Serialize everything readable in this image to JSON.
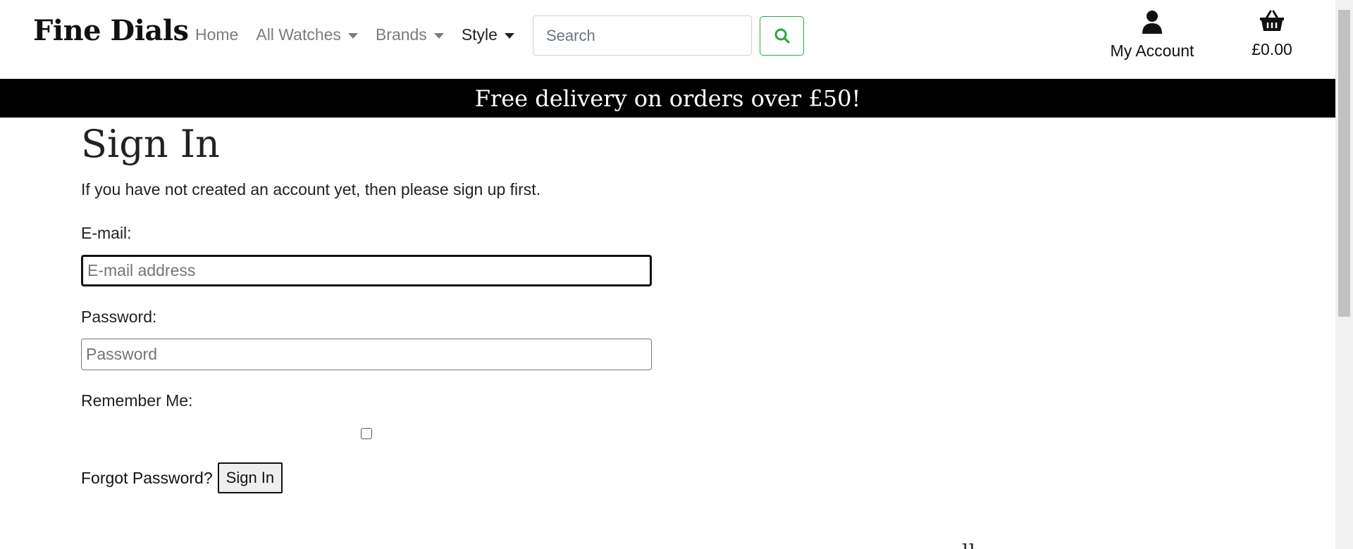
{
  "header": {
    "logo": "Fine Dials",
    "nav": [
      {
        "label": "Home",
        "has_caret": false
      },
      {
        "label": "All Watches",
        "has_caret": true
      },
      {
        "label": "Brands",
        "has_caret": true
      },
      {
        "label": "Style",
        "has_caret": true
      }
    ],
    "search": {
      "placeholder": "Search",
      "button_icon": "search-icon",
      "accent": "#28a745"
    },
    "account": {
      "label": "My Account",
      "icon": "user-icon"
    },
    "basket": {
      "label": "£0.00",
      "icon": "basket-icon"
    }
  },
  "banner": {
    "text": "Free delivery on orders over £50!"
  },
  "form": {
    "title": "Sign In",
    "intro": "If you have not created an account yet, then please sign up first.",
    "email_label": "E-mail:",
    "email_placeholder": "E-mail address",
    "password_label": "Password:",
    "password_placeholder": "Password",
    "remember_label": "Remember Me:",
    "remember_checked": false,
    "forgot_label": "Forgot Password?",
    "submit_label": "Sign In"
  },
  "footer_fragment": "ll"
}
